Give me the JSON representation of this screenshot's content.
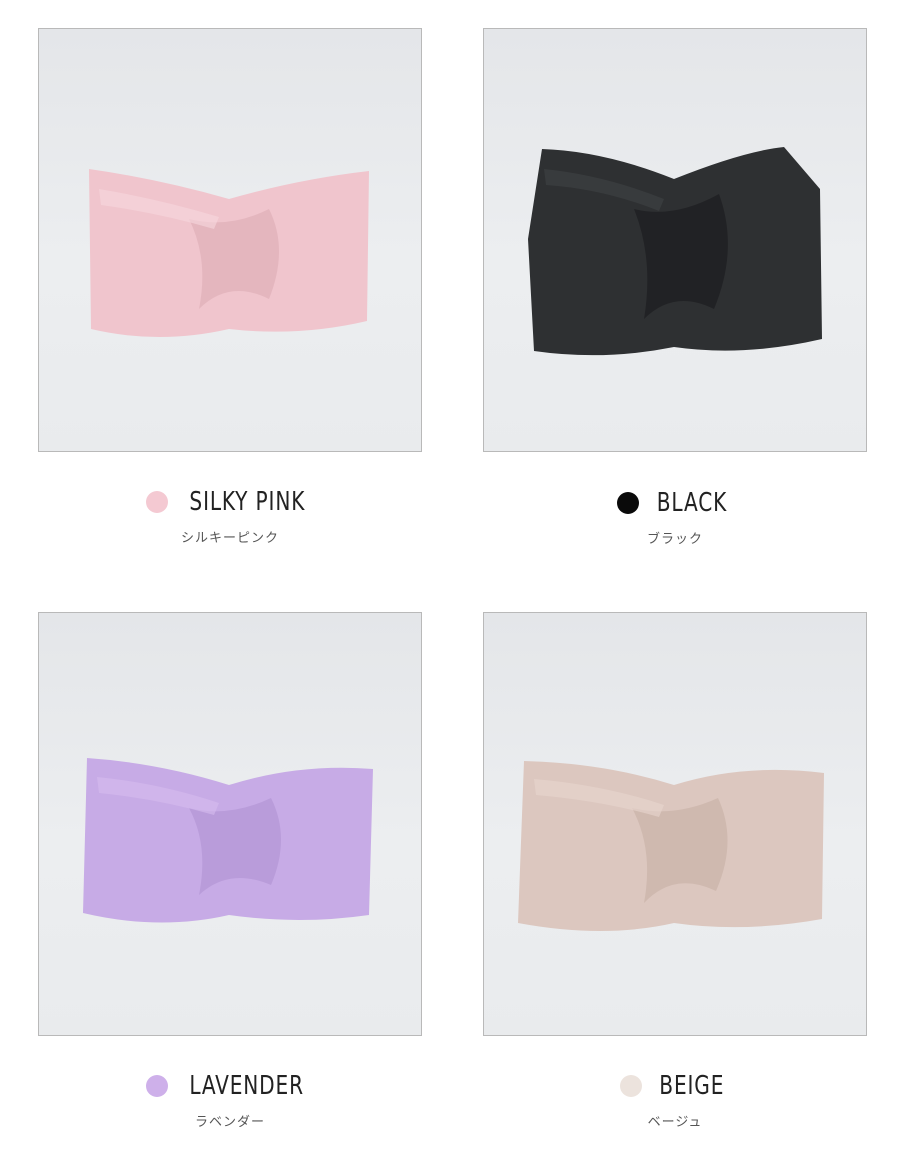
{
  "products": [
    {
      "name": "SILKY PINK",
      "kana": "シルキーピンク",
      "color": "#f4c9d2",
      "band": "#f0c5cd",
      "band_dark": "#dba9b3",
      "band_light": "#f7d7dd"
    },
    {
      "name": "BLACK",
      "kana": "ブラック",
      "color": "#0a0a0a",
      "band": "#2e3032",
      "band_dark": "#1c1d1f",
      "band_light": "#424547"
    },
    {
      "name": "LAVENDER",
      "kana": "ラベンダー",
      "color": "#ceb0ea",
      "band": "#c7abe6",
      "band_dark": "#ad8fd0",
      "band_light": "#d6bdef"
    },
    {
      "name": "BEIGE",
      "kana": "ベージュ",
      "color": "#ece3dd",
      "band": "#dcc7bf",
      "band_dark": "#c4ada3",
      "band_light": "#e8d6cf"
    }
  ]
}
